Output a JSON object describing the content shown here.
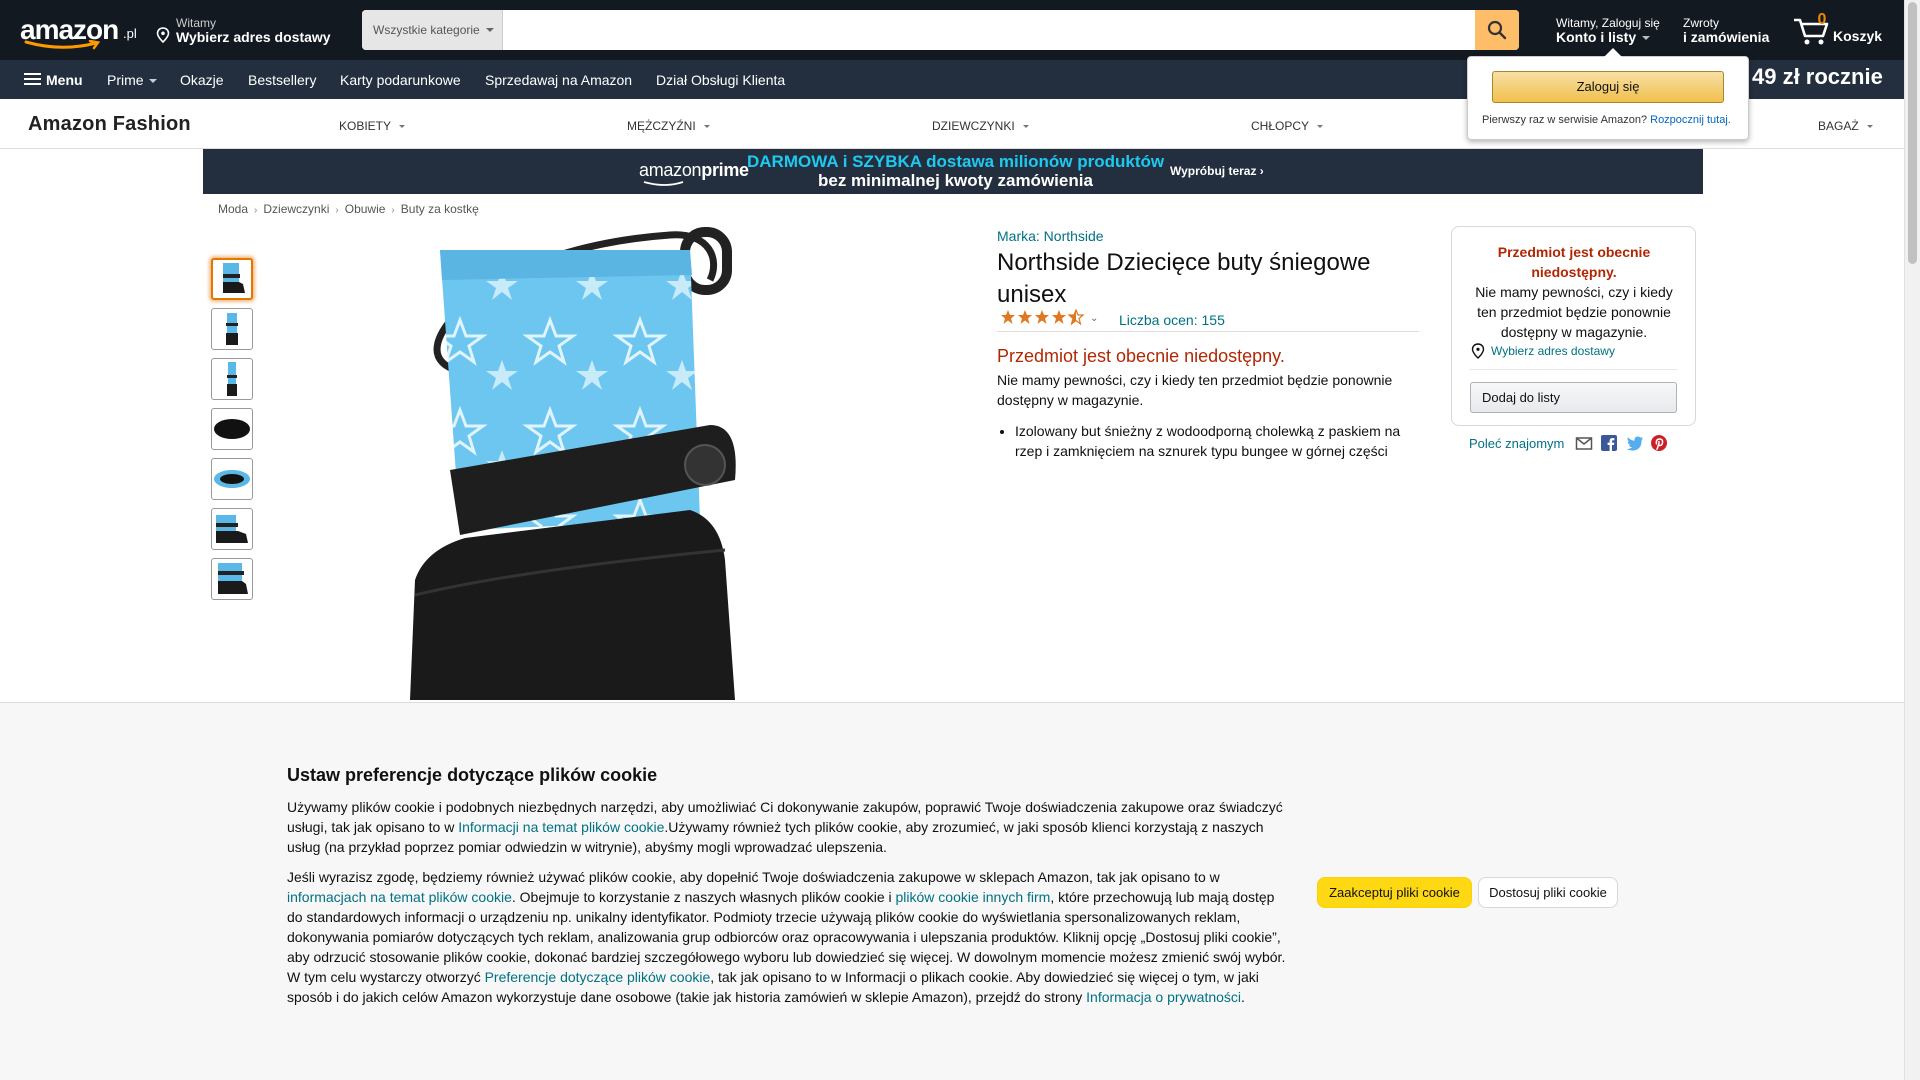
{
  "header": {
    "logo_text": "amazon",
    "logo_tld": ".pl",
    "deliver_greeting": "Witamy",
    "deliver_address": "Wybierz adres dostawy",
    "search_category": "Wszystkie kategorie",
    "search_value": "",
    "account_line1": "Witamy, Zaloguj się",
    "account_line2": "Konto i listy",
    "returns_line1": "Zwroty",
    "returns_line2": "i zamówienia",
    "cart_count": "0",
    "cart_label": "Koszyk"
  },
  "nav": {
    "menu": "Menu",
    "items": [
      "Prime",
      "Okazje",
      "Bestsellery",
      "Karty podarunkowe",
      "Sprzedawaj na Amazon",
      "Dział Obsługi Klienta"
    ],
    "promo": "49 zł rocznie"
  },
  "fashion_nav": {
    "brand": "Amazon Fashion",
    "categories": [
      "KOBIETY",
      "MĘŻCZYŹNI",
      "DZIEWCZYNKI",
      "CHŁOPCY",
      "BAGAŻ"
    ]
  },
  "prime_banner": {
    "logo_a": "amazon",
    "logo_b": "prime",
    "line1": "DARMOWA i SZYBKA dostawa milionów produktów",
    "line2": "bez minimalnej kwoty zamówienia",
    "cta": "Wypróbuj teraz ›"
  },
  "breadcrumb": [
    "Moda",
    "Dziewczynki",
    "Obuwie",
    "Buty za kostkę"
  ],
  "product": {
    "brand_label": "Marka: Northside",
    "title": "Northside Dziecięce buty śniegowe unisex",
    "rating": 4.5,
    "rating_count": "Liczba ocen: 155",
    "unavailable": "Przedmiot jest obecnie niedostępny.",
    "unavailable_desc": "Nie mamy pewności, czy i kiedy ten przedmiot będzie ponownie dostępny w magazynie.",
    "bullets": [
      "Izolowany but śnieżny z wodoodporną cholewką z paskiem na rzep i zamknięciem na sznurek typu bungee w górnej części"
    ],
    "thumbnail_count": 7
  },
  "buybox": {
    "unavailable": "Przedmiot jest obecnie niedostępny.",
    "desc": "Nie mamy pewności, czy i kiedy ten przedmiot będzie ponownie dostępny w magazynie.",
    "address": "Wybierz adres dostawy",
    "add_to_list": "Dodaj do listy",
    "share_label": "Poleć znajomym"
  },
  "flyout": {
    "signin": "Zaloguj się",
    "note": "Pierwszy raz w serwisie Amazon?",
    "link": "Rozpocznij tutaj."
  },
  "cookie": {
    "title": "Ustaw preferencje dotyczące plików cookie",
    "p1_a": "Używamy plików cookie i podobnych niezbędnych narzędzi, aby umożliwiać Ci dokonywanie zakupów, poprawić Twoje doświadczenia zakupowe oraz świadczyć usługi, tak jak opisano to w ",
    "p1_link": "Informacji na temat plików cookie",
    "p1_b": ".Używamy również tych plików cookie, aby zrozumieć, w jaki sposób klienci korzystają z naszych usług (na przykład poprzez pomiar odwiedzin w witrynie), abyśmy mogli wprowadzać ulepszenia.",
    "p2_a": "Jeśli wyrazisz zgodę, będziemy również używać plików cookie, aby dopełnić Twoje doświadczenia zakupowe w sklepach Amazon, tak jak opisano to w ",
    "p2_link1": "informacjach na temat plików cookie",
    "p2_b": ". Obejmuje to korzystanie z naszych własnych plików cookie i ",
    "p2_link2": "plików cookie innych firm",
    "p2_c": ", które przechowują lub mają dostęp do standardowych informacji o urządzeniu np. unikalny identyfikator. Podmioty trzecie używają plików cookie do wyświetlania spersonalizowanych reklam, dokonywania pomiarów dotyczących tych reklam, analizowania grup odbiorców oraz opracowywania i ulepszania produktów. Kliknij opcję „Dostosuj pliki cookie”, aby odrzucić stosowanie plików cookie, dokonać bardziej szczegółowego wyboru lub dowiedzieć się więcej. W dowolnym momencie możesz zmienić swój wybór. W tym celu wystarczy otworzyć ",
    "p2_link3": "Preferencje dotyczące plików cookie",
    "p2_d": ", tak jak opisano to w Informacji o plikach cookie. Aby dowiedzieć się więcej o tym, w jaki sposób i do jakich celów Amazon wykorzystuje dane osobowe (takie jak historia zamówień w sklepie Amazon), przejdź do strony ",
    "p2_link4": "Informacja o prywatności",
    "p2_e": ".",
    "accept": "Zaakceptuj pliki cookie",
    "customize": "Dostosuj pliki cookie"
  },
  "colors": {
    "nav_dark": "#131921",
    "nav_secondary": "#232f3e",
    "search_button": "#febd69",
    "link": "#007185",
    "unavailable_red": "#b12704",
    "prime_blue": "#1ec9f0",
    "cta_yellow": "#ffd814"
  },
  "icons": [
    "location-pin-icon",
    "search-icon",
    "cart-icon",
    "hamburger-icon",
    "star-icon",
    "email-icon",
    "facebook-icon",
    "twitter-icon",
    "pinterest-icon"
  ]
}
